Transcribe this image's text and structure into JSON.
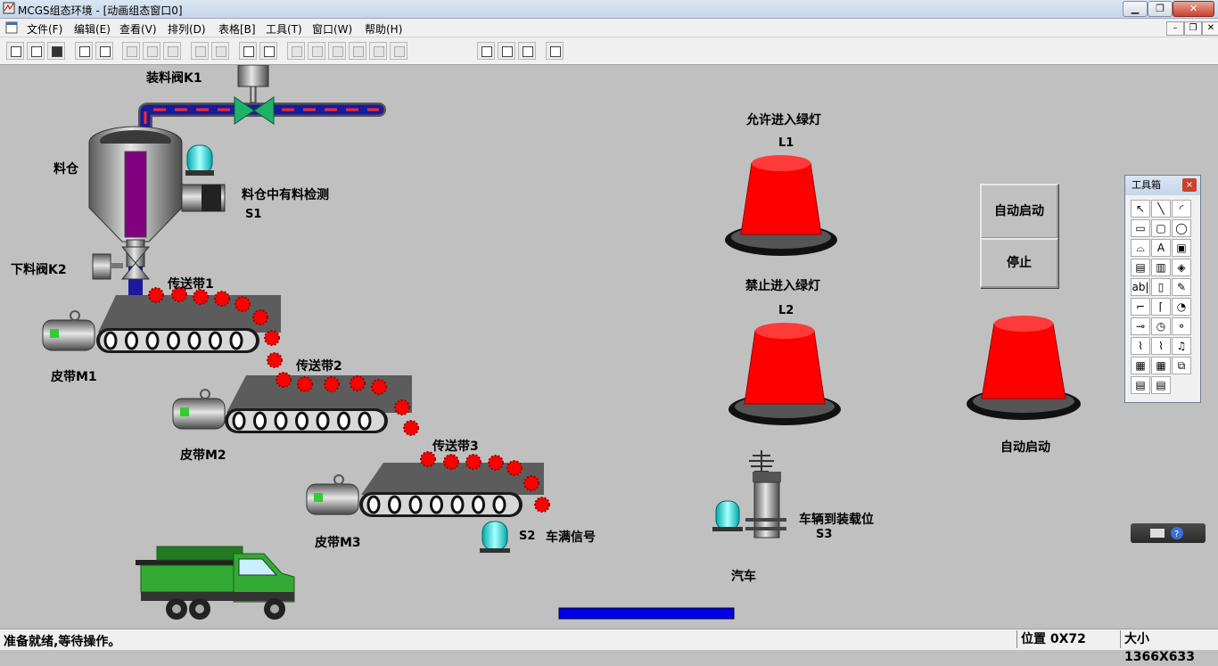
{
  "window": {
    "title": "MCGS组态环境 - [动画组态窗口0]"
  },
  "menu": [
    "文件(F)",
    "编辑(E)",
    "查看(V)",
    "排列(D)",
    "表格[B]",
    "工具(T)",
    "窗口(W)",
    "帮助(H)"
  ],
  "labels": {
    "feed_valve": "装料阀K1",
    "silo": "料仓",
    "silo_sensor": "料仓中有料检测",
    "s1": "S1",
    "discharge_valve": "下料阀K2",
    "belt1": "传送带1",
    "belt2": "传送带2",
    "belt3": "传送带3",
    "motor1": "皮带M1",
    "motor2": "皮带M2",
    "motor3": "皮带M3",
    "s2": "S2",
    "truck_full": "车满信号",
    "allow_green": "允许进入绿灯",
    "l1": "L1",
    "forbid_green": "禁止进入绿灯",
    "l2": "L2",
    "truck_position": "车辆到装载位",
    "s3": "S3",
    "truck": "汽车",
    "auto_lamp": "自动启动"
  },
  "buttons": {
    "auto_start": "自动启动",
    "stop": "停止"
  },
  "toolbox": {
    "title": "工具箱",
    "close": "×",
    "tools": [
      "↖",
      "╲",
      "◜",
      "▭",
      "▢",
      "◯",
      "⌓",
      "A",
      "▣",
      "▤",
      "▥",
      "◈",
      "ab|",
      "▯",
      "✎",
      "⌐",
      "⌈",
      "◔",
      "⊸",
      "◷",
      "⚬",
      "⌇",
      "⌇",
      "♫",
      "▦",
      "▦",
      "⧉",
      "▤",
      "▤"
    ]
  },
  "status": {
    "message": "准备就绪,等待操作。",
    "position": "位置 0X72",
    "size": "大小 1366X633"
  },
  "colors": {
    "red_lamp": "#ff0000",
    "sensor": "#22e0e0",
    "pipe": "#1a1a9e",
    "silo_window": "#800080",
    "truck": "#33aa33",
    "progress": "#0000e8"
  }
}
